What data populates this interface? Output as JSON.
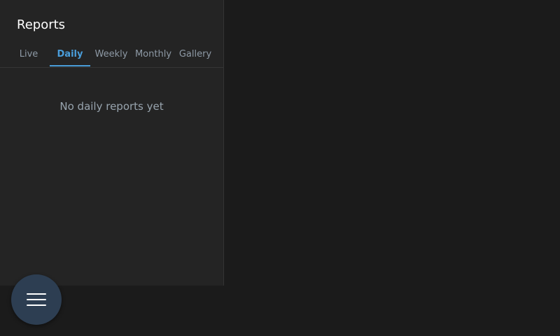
{
  "panel": {
    "title": "Reports",
    "tabs": [
      {
        "label": "Live",
        "active": false
      },
      {
        "label": "Daily",
        "active": true
      },
      {
        "label": "Weekly",
        "active": false
      },
      {
        "label": "Monthly",
        "active": false
      },
      {
        "label": "Gallery",
        "active": false
      }
    ],
    "empty_message": "No daily reports yet"
  },
  "fab": {
    "icon": "menu-icon"
  },
  "colors": {
    "accent": "#4a9edb",
    "panel_bg": "#242424",
    "app_bg": "#1b1b1b",
    "fab_bg": "#2d3e52"
  }
}
